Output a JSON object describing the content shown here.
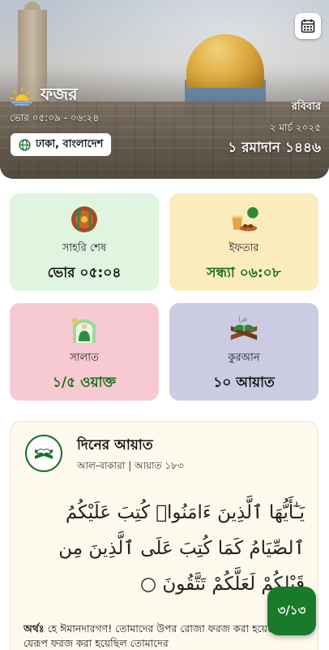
{
  "header": {
    "prayer_name": "ফজর",
    "prayer_time": "ভোর ০৫:০৯ - ০৬:২৪",
    "location": "ঢাকা, বাংলাদেশ",
    "weekday": "রবিবার",
    "gregorian_date": "২ মার্চ ২০২৫",
    "hijri_date": "১ রমাদান ১৪৪৬",
    "icons": {
      "prayer": "sunrise-icon",
      "location": "globe-icon",
      "calendar": "calendar-icon"
    }
  },
  "cards": [
    {
      "label": "সাহরি শেষ",
      "value": "ভোর ০৫:০৪",
      "icon": "suhoor-icon",
      "value_color": "#111111"
    },
    {
      "label": "ইফতার",
      "value": "সন্ধ্যা ০৬:০৮",
      "icon": "iftar-icon",
      "value_color": "#1a6b1a"
    },
    {
      "label": "সালাত",
      "value": "১/৫ ওয়াক্ত",
      "icon": "salat-icon",
      "value_color": "#1a6b1a"
    },
    {
      "label": "কুরআন",
      "value": "১০ আয়াত",
      "icon": "quran-icon",
      "value_color": "#111111"
    }
  ],
  "ayah": {
    "title": "দিনের আয়াত",
    "reference": "আল-বাকারা | আয়াত ১৮৩",
    "arabic": "يَـٰٓأَيُّهَا ٱلَّذِينَ ءَامَنُوا۟ كُتِبَ عَلَيْكُمُ ٱلصِّيَامُ كَمَا كُتِبَ عَلَى ٱلَّذِينَ مِن قَبْلِكُمْ لَعَلَّكُمْ تَتَّقُونَ ○",
    "meaning_label": "অর্থঃ",
    "meaning_text": "হে ঈমানদারগণ! তোমাদের উপর রোজা ফরজ করা হয়েছে, যেরূপ ফরজ করা হয়েছিল তোমাদের"
  },
  "fab": {
    "label": "৩/১৩"
  },
  "colors": {
    "accent": "#1a7a2c",
    "suhoor_bg": "#dff5df",
    "iftar_bg": "#fbecbe",
    "salat_bg": "#f7c9d2",
    "quran_bg": "#cbcbe2"
  }
}
